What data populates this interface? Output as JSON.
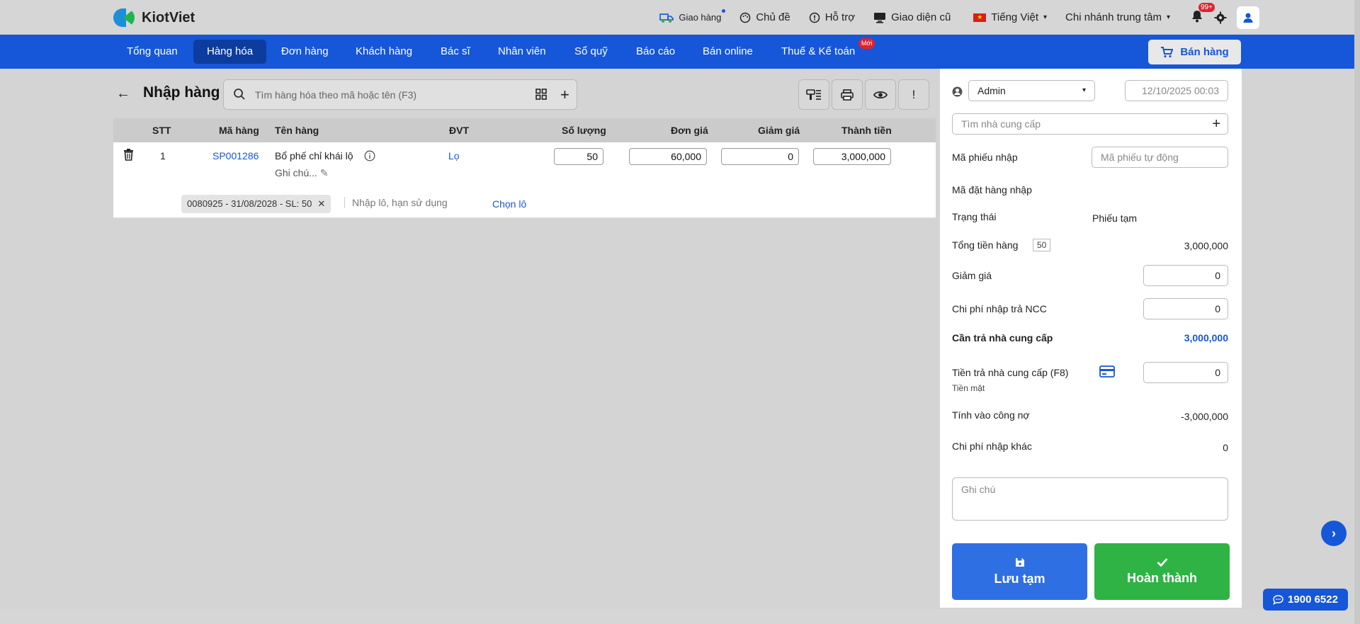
{
  "brand": {
    "name": "KiotViet"
  },
  "topbar": {
    "delivery": "Giao hàng",
    "theme": "Chủ đề",
    "support": "Hỗ trợ",
    "old_ui": "Giao diện cũ",
    "language": "Tiếng Việt",
    "branch": "Chi nhánh trung tâm",
    "notifications": "99+"
  },
  "nav": {
    "items": [
      "Tổng quan",
      "Hàng hóa",
      "Đơn hàng",
      "Khách hàng",
      "Bác sĩ",
      "Nhân viên",
      "Sổ quỹ",
      "Báo cáo",
      "Bán online",
      "Thuế & Kế toán"
    ],
    "active": "Hàng hóa",
    "new_badge": "Mới",
    "sell_button": "Bán hàng"
  },
  "page": {
    "title": "Nhập hàng",
    "search_placeholder": "Tìm hàng hóa theo mã hoặc tên (F3)"
  },
  "table": {
    "headers": [
      "STT",
      "Mã hàng",
      "Tên hàng",
      "ĐVT",
      "Số lượng",
      "Đơn giá",
      "Giảm giá",
      "Thành tiền"
    ],
    "rows": [
      {
        "stt": "1",
        "code": "SP001286",
        "name": "Bổ phế chỉ khái lộ",
        "note": "Ghi chú...",
        "unit": "Lọ",
        "qty": "50",
        "price": "60,000",
        "discount": "0",
        "total": "3,000,000",
        "lot": "0080925 - 31/08/2028 - SL: 50",
        "lot_placeholder": "Nhập lô, hạn sử dụng",
        "choose_lot": "Chọn lô"
      }
    ]
  },
  "panel": {
    "user": "Admin",
    "datetime": "12/10/2025 00:03",
    "supplier_placeholder": "Tìm nhà cung cấp",
    "receipt_code_label": "Mã phiếu nhập",
    "receipt_code_placeholder": "Mã phiếu tự động",
    "order_code_label": "Mã đặt hàng nhập",
    "status_label": "Trạng thái",
    "status_value": "Phiếu tạm",
    "total_label": "Tổng tiền hàng",
    "total_qty": "50",
    "total_value": "3,000,000",
    "discount_label": "Giảm giá",
    "discount_value": "0",
    "return_fee_label": "Chi phí nhập trả NCC",
    "return_fee_value": "0",
    "need_pay_label": "Cần trả nhà cung cấp",
    "need_pay_value": "3,000,000",
    "paid_label": "Tiền trả nhà cung cấp (F8)",
    "paid_method": "Tiền mặt",
    "paid_value": "0",
    "debt_label": "Tính vào công nợ",
    "debt_value": "-3,000,000",
    "other_fee_label": "Chi phí nhập khác",
    "other_fee_value": "0",
    "note_placeholder": "Ghi chú",
    "save_draft": "Lưu tạm",
    "complete": "Hoàn thành"
  },
  "hotline": "1900 6522",
  "colors": {
    "primary": "#1656d8",
    "success": "#2fb344",
    "danger": "#e0222e"
  }
}
